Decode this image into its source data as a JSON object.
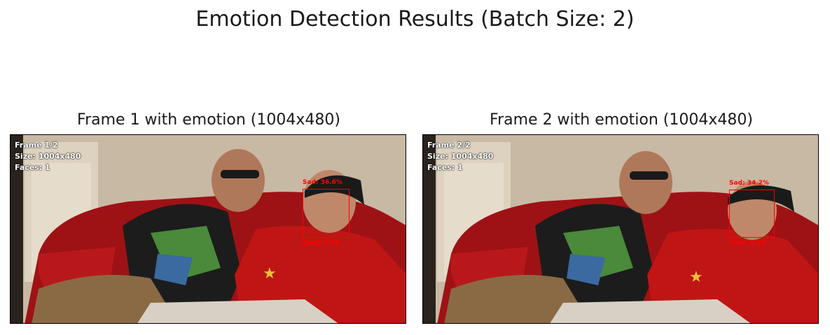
{
  "suptitle": "Emotion Detection Results (Batch Size: 2)",
  "frames": [
    {
      "title": "Frame 1 with emotion (1004x480)",
      "overlay": [
        "Frame 1/2",
        "Size: 1004x480",
        "Faces: 1"
      ],
      "detection": {
        "emotion_label": "Sad: 36.6%",
        "conf_label": "Conf: 0.79"
      }
    },
    {
      "title": "Frame 2 with emotion (1004x480)",
      "overlay": [
        "Frame 2/2",
        "Size: 1004x480",
        "Faces: 1"
      ],
      "detection": {
        "emotion_label": "Sad: 34.2%",
        "conf_label": "Conf: 0.84"
      }
    }
  ],
  "colors": {
    "box": "#ff0000",
    "overlay_text": "#ffffff"
  }
}
